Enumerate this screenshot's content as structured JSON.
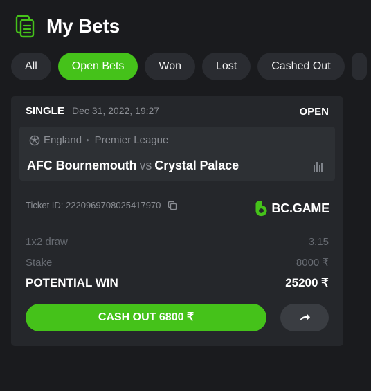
{
  "header": {
    "title": "My Bets",
    "icon": "bets-list-icon"
  },
  "tabs": [
    {
      "label": "All",
      "active": false
    },
    {
      "label": "Open Bets",
      "active": true
    },
    {
      "label": "Won",
      "active": false
    },
    {
      "label": "Lost",
      "active": false
    },
    {
      "label": "Cashed Out",
      "active": false
    }
  ],
  "bet": {
    "type": "SINGLE",
    "date": "Dec 31, 2022, 19:27",
    "status": "OPEN",
    "league": {
      "country": "England",
      "competition": "Premier League",
      "icon": "soccer-ball-icon"
    },
    "match": {
      "home": "AFC Bournemouth",
      "vs": "vs",
      "away": "Crystal Palace",
      "stats_icon": "stats-icon"
    },
    "ticket": {
      "label": "Ticket ID: 2220969708025417970",
      "copy_icon": "copy-icon"
    },
    "brand": {
      "name": "BC.GAME",
      "icon": "bc-game-logo"
    },
    "selection": {
      "label": "1x2 draw",
      "odds": "3.15"
    },
    "stake": {
      "label": "Stake",
      "value": "8000 ₹"
    },
    "potential_win": {
      "label": "POTENTIAL WIN",
      "value": "25200 ₹"
    },
    "cashout": {
      "label": "CASH OUT 6800 ₹"
    },
    "share": {
      "icon": "share-icon"
    }
  },
  "colors": {
    "background": "#1a1b1e",
    "card": "#25272b",
    "accent": "#45c21a",
    "muted_text": "#8b8e94"
  }
}
